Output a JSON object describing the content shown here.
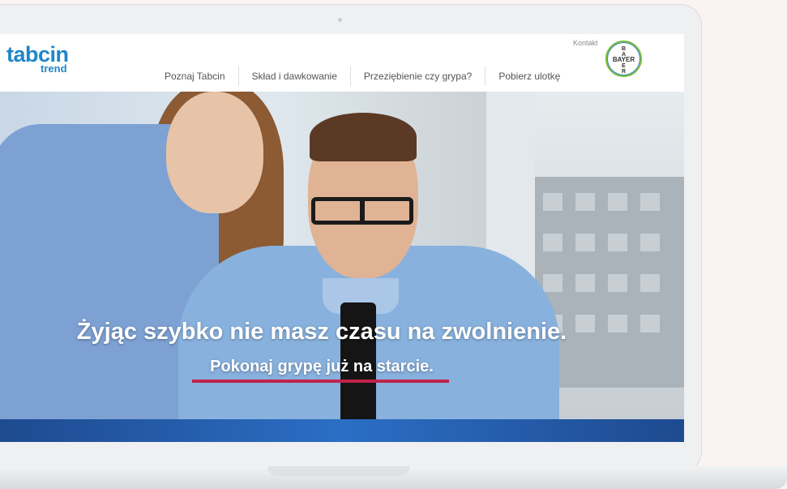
{
  "logo": {
    "main": "tabcin",
    "sub": "trend",
    "color": "#1f86c8"
  },
  "nav": {
    "items": [
      {
        "label": "Poznaj Tabcin"
      },
      {
        "label": "Skład i dawkowanie"
      },
      {
        "label": "Przeziębienie czy grypa?"
      },
      {
        "label": "Pobierz ulotkę"
      }
    ]
  },
  "header": {
    "contact_label": "Kontakt"
  },
  "bayer_logo": {
    "letters": [
      "B",
      "A",
      "Y",
      "E",
      "R"
    ],
    "ring_green": "#7cbb3a",
    "ring_blue": "#2f7fc0"
  },
  "hero": {
    "headline": "Żyjąc szybko nie masz czasu na zwolnienie.",
    "subheadline": "Pokonaj grypę już na starcie.",
    "accent_color": "#c0234a"
  }
}
